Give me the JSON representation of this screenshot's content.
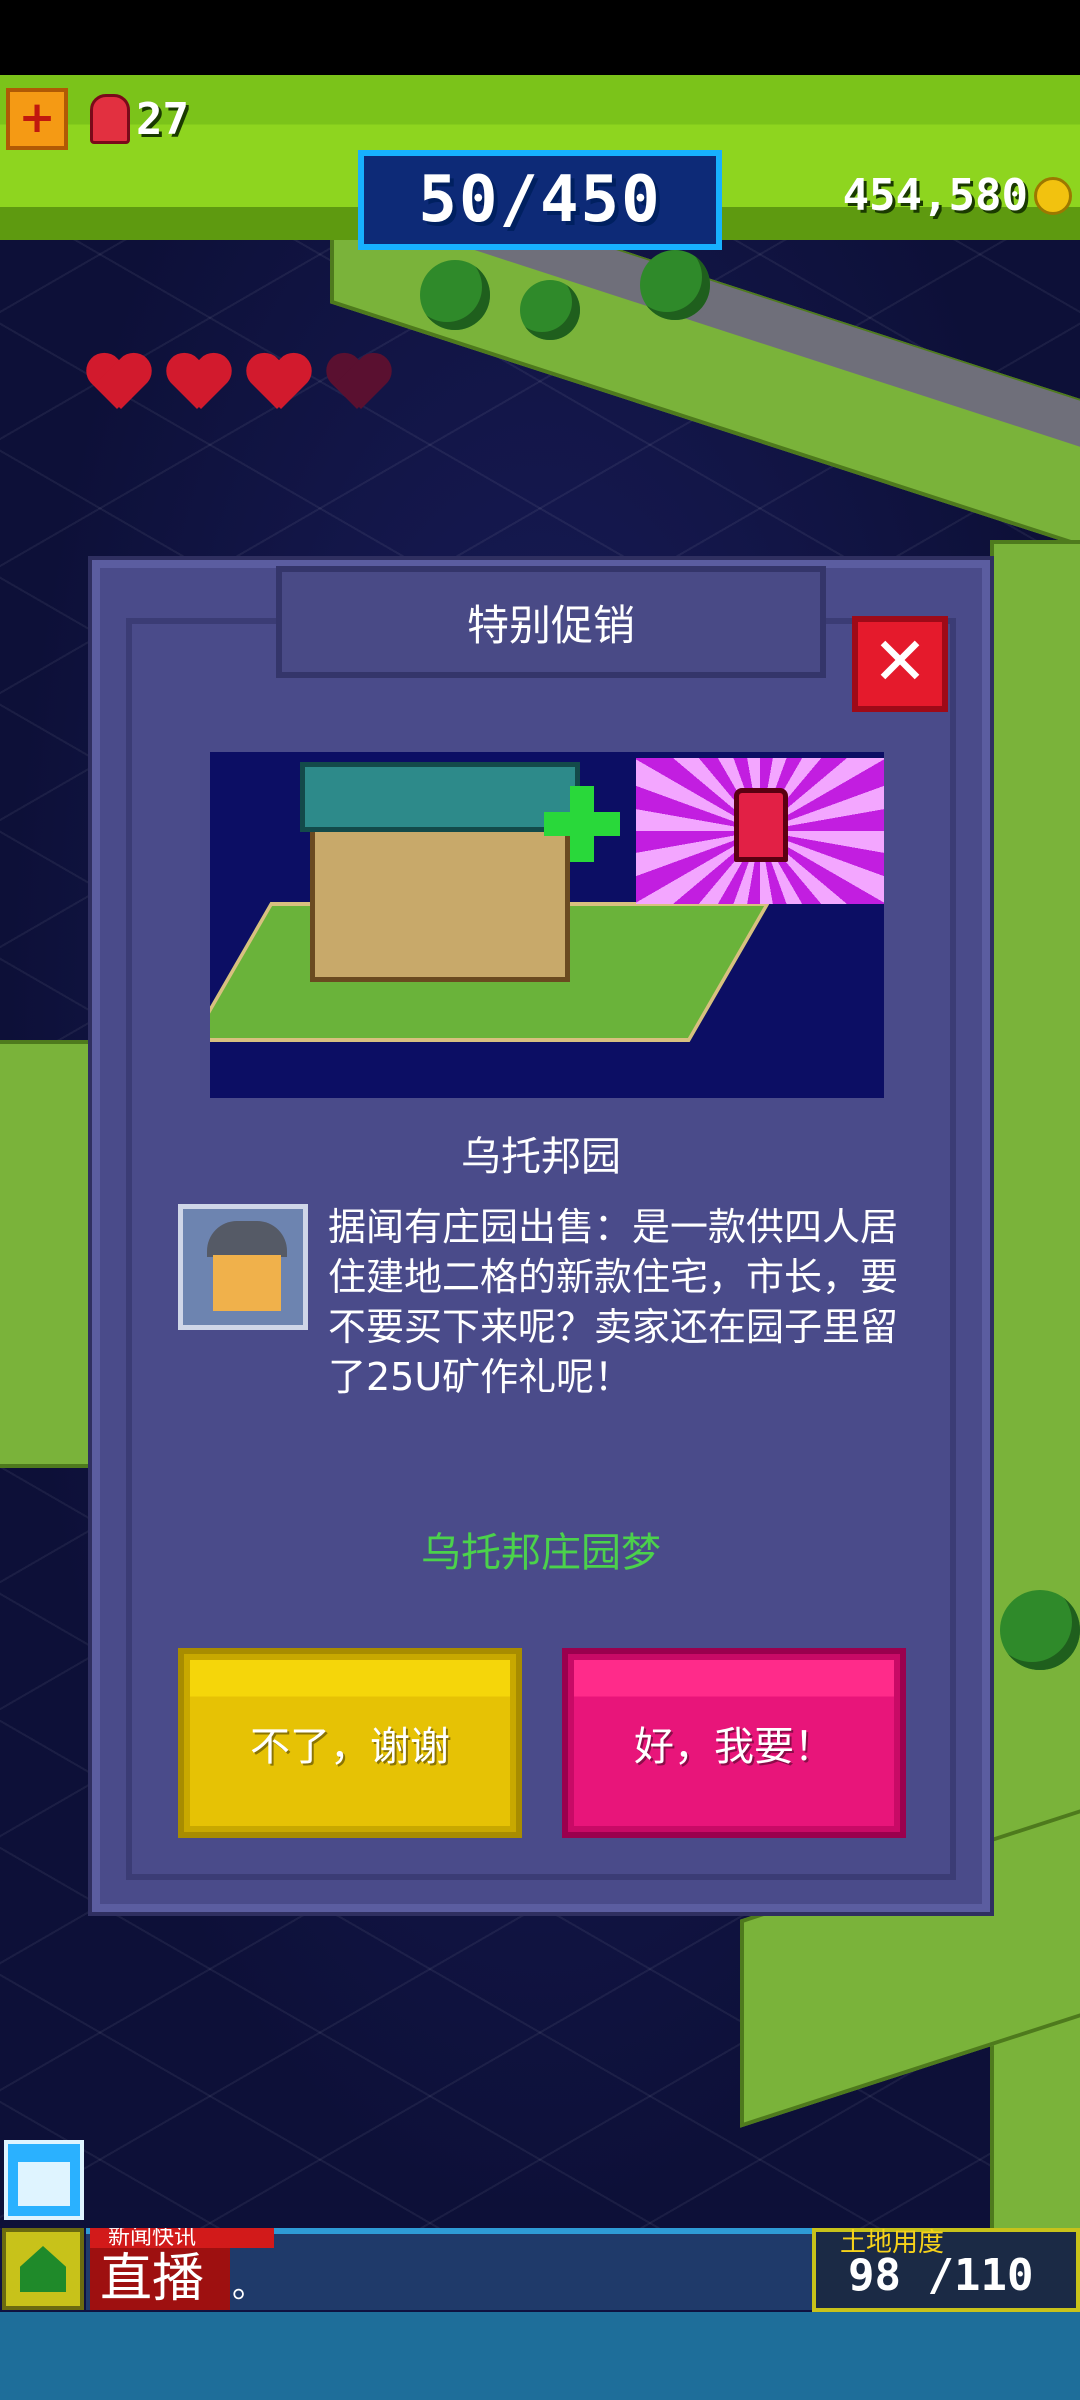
{
  "hud": {
    "siren_count": "27",
    "xp": "50/450",
    "coins": "454,580"
  },
  "modal": {
    "title": "特别促销",
    "close_icon": "close-x-icon",
    "item_name": "乌托邦园",
    "description": "据闻有庄园出售：是一款供四人居住建地二格的新款住宅，市长，要不要买下来呢？卖家还在园子里留了25U矿作礼呢！",
    "offer_name": "乌托邦庄园梦",
    "decline_label": "不了，谢谢",
    "accept_label": "好，我要！"
  },
  "bottom": {
    "news_tag": "新闻快讯",
    "live_label": "直播",
    "news_text": "。",
    "land_label": "土地用度",
    "land_count": "98 /110"
  },
  "colors": {
    "hud_green": "#8ed51f",
    "xp_blue": "#17b1ff",
    "modal_bg": "#4a4b8a",
    "decline_yellow": "#e6c205",
    "accept_pink": "#e8157a",
    "offer_green": "#4bd24b"
  }
}
